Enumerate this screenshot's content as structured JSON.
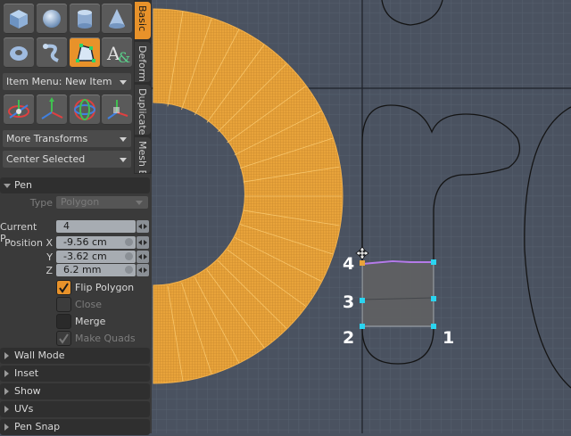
{
  "toolbar": {
    "row1": [
      {
        "name": "cube-icon"
      },
      {
        "name": "sphere-icon"
      },
      {
        "name": "cylinder-icon"
      },
      {
        "name": "cone-icon"
      }
    ],
    "row2": [
      {
        "name": "torus-icon"
      },
      {
        "name": "tube-icon"
      },
      {
        "name": "pen-tool-icon",
        "active": true
      },
      {
        "name": "text-tool-icon"
      }
    ],
    "row3": [
      {
        "name": "move-transform-icon"
      },
      {
        "name": "rotate-transform-icon"
      },
      {
        "name": "scale-transform-icon"
      },
      {
        "name": "transform-icon"
      }
    ]
  },
  "tabs": [
    {
      "label": "Basic",
      "active": true
    },
    {
      "label": "Deform",
      "active": false
    },
    {
      "label": "Duplicate",
      "active": false
    },
    {
      "label": "Mesh E",
      "active": false
    }
  ],
  "dropdowns": {
    "item_menu": "Item Menu: New Item",
    "more_transforms": "More Transforms",
    "center_selected": "Center Selected"
  },
  "pen": {
    "header": "Pen",
    "type_label": "Type",
    "type_value": "Polygon",
    "current_point_label": "Current P...",
    "current_point_value": "4",
    "position_x_label": "Position X",
    "position_x_value": "-9.56 cm",
    "y_label": "Y",
    "y_value": "-3.62 cm",
    "z_label": "Z",
    "z_value": "6.2 mm",
    "flip_polygon_label": "Flip Polygon",
    "flip_polygon_checked": true,
    "close_label": "Close",
    "close_checked": false,
    "merge_label": "Merge",
    "merge_checked": false,
    "make_quads_label": "Make Quads",
    "make_quads_checked": true
  },
  "collapsed_sections": [
    "Wall Mode",
    "Inset",
    "Show",
    "UVs",
    "Pen Snap"
  ],
  "viewport": {
    "point_labels": [
      "4",
      "3",
      "2",
      "1"
    ],
    "colors": {
      "background": "#4a5260",
      "grid": "#56606e",
      "mesh": "#e8a33a",
      "outline": "#141414",
      "vertex": "#2ad4f0",
      "selected_edge": "#b57ae8"
    }
  }
}
